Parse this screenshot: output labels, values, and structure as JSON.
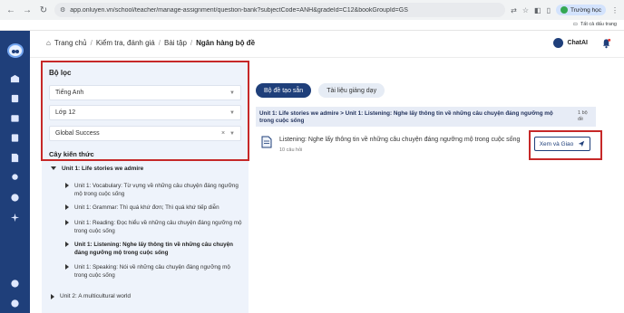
{
  "browser": {
    "url": "app.onluyen.vn/school/teacher/manage-assignment/question-bank?subjectCode=ANH&gradeId=C12&bookGroupId=GS",
    "profile_label": "Trường học",
    "bookmarks_all": "Tất cả dấu trang"
  },
  "breadcrumb": {
    "home": "Trang chủ",
    "item1": "Kiểm tra, đánh giá",
    "item2": "Bài tập",
    "current": "Ngân hàng bộ đề"
  },
  "header": {
    "chatai_label": "ChatAI"
  },
  "filter": {
    "title": "Bộ lọc",
    "subject": "Tiếng Anh",
    "grade": "Lớp 12",
    "book": "Global Success",
    "tree_title": "Cây kiến thức"
  },
  "tree": {
    "root1": "Unit 1: Life stories we admire",
    "items": [
      "Unit 1: Vocabulary: Từ vựng về những câu chuyện đáng ngưỡng mộ trong cuộc sống",
      "Unit 1: Grammar: Thì quá khứ đơn; Thì quá khứ tiếp diễn",
      "Unit 1: Reading: Đọc hiểu về những câu chuyện đáng ngưỡng mộ trong cuộc sống",
      "Unit 1: Listening: Nghe lấy thông tin về những câu chuyện đáng ngưỡng mộ trong cuộc sống",
      "Unit 1: Speaking: Nói về những câu chuyện đáng ngưỡng mộ trong cuộc sống"
    ],
    "root2": "Unit 2: A multicultural world"
  },
  "content": {
    "tab_active": "Bộ đề tạo sẵn",
    "tab_inactive": "Tài liệu giảng dạy",
    "group_path": "Unit 1: Life stories we admire > Unit 1: Listening: Nghe lấy thông tin về những câu chuyện đáng ngưỡng mộ trong cuộc sống",
    "group_count": "1 bộ đề",
    "exercise_title": "Listening: Nghe lấy thông tin về những câu chuyện đáng ngưỡng mộ trong cuộc sống",
    "exercise_sub": "10 câu hỏi",
    "view_button": "Xem và Giao"
  },
  "colors": {
    "sidebar": "#1f3f7a",
    "highlight_border": "#c62828",
    "filter_bg": "#eef3fb"
  }
}
